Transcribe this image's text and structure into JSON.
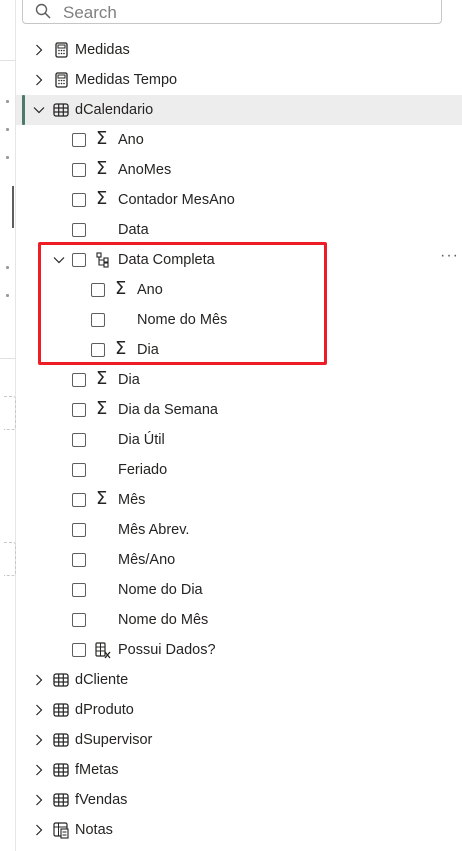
{
  "search": {
    "placeholder": "Search"
  },
  "tree": {
    "medidas": "Medidas",
    "medidas_tempo": "Medidas Tempo",
    "dcalendario": "dCalendario",
    "ano": "Ano",
    "anomes": "AnoMes",
    "contador": "Contador MesAno",
    "data": "Data",
    "data_completa": "Data Completa",
    "hier_ano": "Ano",
    "hier_nome_mes": "Nome do Mês",
    "hier_dia": "Dia",
    "dia": "Dia",
    "dia_semana": "Dia da Semana",
    "dia_util": "Dia Útil",
    "feriado": "Feriado",
    "mes": "Mês",
    "mes_abrev": "Mês Abrev.",
    "mes_ano": "Mês/Ano",
    "nome_dia": "Nome do Dia",
    "nome_mes": "Nome do Mês",
    "possui_dados": "Possui Dados?",
    "dcliente": "dCliente",
    "dproduto": "dProduto",
    "dsupervisor": "dSupervisor",
    "fmetas": "fMetas",
    "fvendas": "fVendas",
    "notas": "Notas"
  },
  "colors": {
    "highlight": "#ee1c25",
    "selected_bar": "#4e7a6c"
  }
}
